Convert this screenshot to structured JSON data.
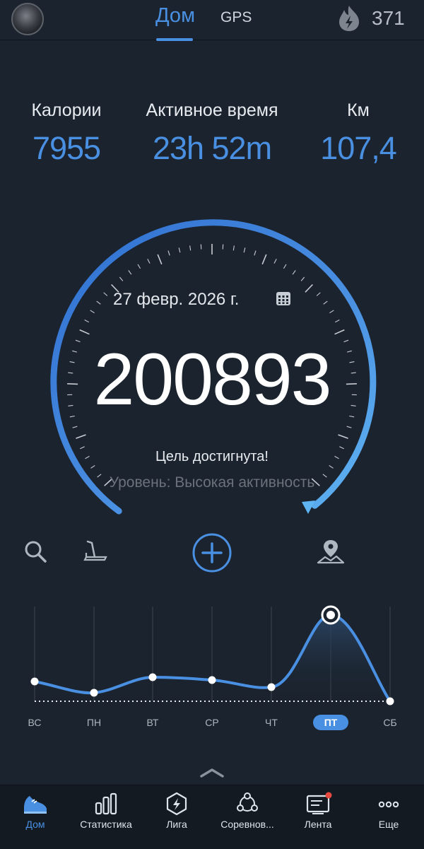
{
  "header": {
    "tabs": [
      "Дом",
      "GPS"
    ],
    "active_tab": "Дом",
    "streak_count": "371",
    "accent_color": "#4a90e2"
  },
  "stats": [
    {
      "label": "Калории",
      "value": "7955"
    },
    {
      "label": "Активное время",
      "value": "23h 52m"
    },
    {
      "label": "Км",
      "value": "107,4"
    }
  ],
  "dial": {
    "date": "27 февр. 2026 г.",
    "steps": "200893",
    "status": "Цель достигнута!",
    "level": "Уровень: Высокая активность"
  },
  "tools": [
    "search-icon",
    "treadmill-icon",
    "add-icon",
    "location-icon"
  ],
  "weekly_chart": {
    "days": [
      "ВС",
      "ПН",
      "ВТ",
      "СР",
      "ЧТ",
      "ПТ",
      "СБ"
    ],
    "active_day": "ПТ"
  },
  "bottom_nav": [
    {
      "label": "Дом",
      "icon": "shoe-icon"
    },
    {
      "label": "Статистика",
      "icon": "bar-chart-icon"
    },
    {
      "label": "Лига",
      "icon": "league-icon"
    },
    {
      "label": "Соревнов...",
      "icon": "challenges-icon"
    },
    {
      "label": "Лента",
      "icon": "feed-icon"
    },
    {
      "label": "Еще",
      "icon": "more-icon"
    }
  ]
}
